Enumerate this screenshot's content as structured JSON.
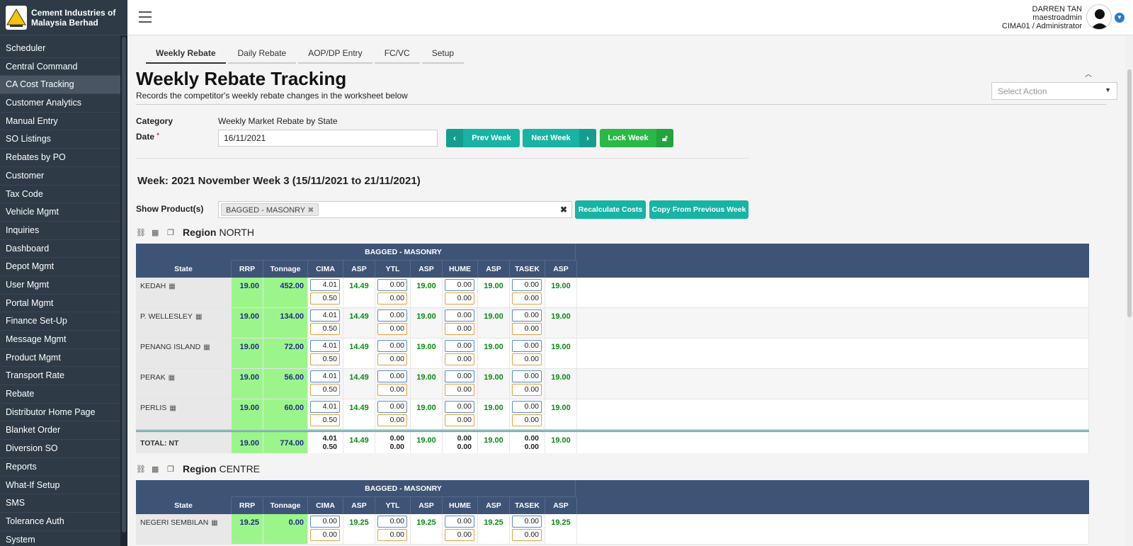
{
  "app": {
    "company_name": "Cement Industries of Malaysia Berhad",
    "user": {
      "name": "DARREN TAN",
      "login": "maestroadmin",
      "role": "CIMA01 / Administrator"
    }
  },
  "sidebar": {
    "items": [
      {
        "label": "Scheduler"
      },
      {
        "label": "Central Command"
      },
      {
        "label": "CA Cost Tracking"
      },
      {
        "label": "Customer Analytics"
      },
      {
        "label": "Manual Entry"
      },
      {
        "label": "SO Listings"
      },
      {
        "label": "Rebates by PO"
      },
      {
        "label": "Customer"
      },
      {
        "label": "Tax Code"
      },
      {
        "label": "Vehicle Mgmt"
      },
      {
        "label": "Inquiries"
      },
      {
        "label": "Dashboard"
      },
      {
        "label": "Depot Mgmt"
      },
      {
        "label": "User Mgmt"
      },
      {
        "label": "Portal Mgmt"
      },
      {
        "label": "Finance Set-Up"
      },
      {
        "label": "Message Mgmt"
      },
      {
        "label": "Product Mgmt"
      },
      {
        "label": "Transport Rate"
      },
      {
        "label": "Rebate"
      },
      {
        "label": "Distributor Home Page"
      },
      {
        "label": "Blanket Order"
      },
      {
        "label": "Diversion SO"
      },
      {
        "label": "Reports"
      },
      {
        "label": "What-If Setup"
      },
      {
        "label": "SMS"
      },
      {
        "label": "Tolerance Auth"
      },
      {
        "label": "System"
      }
    ],
    "active_index": 2
  },
  "tabs": [
    {
      "label": "Weekly Rebate",
      "active": true
    },
    {
      "label": "Daily Rebate"
    },
    {
      "label": "AOP/DP Entry"
    },
    {
      "label": "FC/VC"
    },
    {
      "label": "Setup"
    }
  ],
  "page": {
    "title": "Weekly Rebate Tracking",
    "subtitle": "Records the competitor's weekly rebate changes in the worksheet below",
    "action_placeholder": "Select Action"
  },
  "form": {
    "category_label": "Category",
    "category_value": "Weekly Market Rebate by State",
    "date_label": "Date",
    "date_value": "16/11/2021",
    "prev_week": "Prev Week",
    "next_week": "Next Week",
    "lock_week": "Lock Week"
  },
  "week_title": "Week: 2021 November Week 3 (15/11/2021 to 21/11/2021)",
  "products": {
    "label": "Show Product(s)",
    "selected": "BAGGED - MASONRY",
    "recalc": "Recalculate Costs",
    "copy_prev": "Copy From Previous Week"
  },
  "table_headers": {
    "group": "BAGGED - MASONRY",
    "columns": [
      "State",
      "RRP",
      "Tonnage",
      "CIMA",
      "ASP",
      "YTL",
      "ASP",
      "HUME",
      "ASP",
      "TASEK",
      "ASP"
    ]
  },
  "regions": [
    {
      "label": "Region",
      "name": "NORTH",
      "rows": [
        {
          "state": "KEDAH",
          "rrp": "19.00",
          "tonnage": "452.00",
          "cima": [
            "4.01",
            "0.50"
          ],
          "cima_asp": "14.49",
          "ytl": [
            "0.00",
            "0.00"
          ],
          "ytl_asp": "19.00",
          "hume": [
            "0.00",
            "0.00"
          ],
          "hume_asp": "19.00",
          "tasek": [
            "0.00",
            "0.00"
          ],
          "tasek_asp": "19.00"
        },
        {
          "state": "P. WELLESLEY",
          "rrp": "19.00",
          "tonnage": "134.00",
          "cima": [
            "4.01",
            "0.50"
          ],
          "cima_asp": "14.49",
          "ytl": [
            "0.00",
            "0.00"
          ],
          "ytl_asp": "19.00",
          "hume": [
            "0.00",
            "0.00"
          ],
          "hume_asp": "19.00",
          "tasek": [
            "0.00",
            "0.00"
          ],
          "tasek_asp": "19.00"
        },
        {
          "state": "PENANG ISLAND",
          "rrp": "19.00",
          "tonnage": "72.00",
          "cima": [
            "4.01",
            "0.50"
          ],
          "cima_asp": "14.49",
          "ytl": [
            "0.00",
            "0.00"
          ],
          "ytl_asp": "19.00",
          "hume": [
            "0.00",
            "0.00"
          ],
          "hume_asp": "19.00",
          "tasek": [
            "0.00",
            "0.00"
          ],
          "tasek_asp": "19.00"
        },
        {
          "state": "PERAK",
          "rrp": "19.00",
          "tonnage": "56.00",
          "cima": [
            "4.01",
            "0.50"
          ],
          "cima_asp": "14.49",
          "ytl": [
            "0.00",
            "0.00"
          ],
          "ytl_asp": "19.00",
          "hume": [
            "0.00",
            "0.00"
          ],
          "hume_asp": "19.00",
          "tasek": [
            "0.00",
            "0.00"
          ],
          "tasek_asp": "19.00"
        },
        {
          "state": "PERLIS",
          "rrp": "19.00",
          "tonnage": "60.00",
          "cima": [
            "4.01",
            "0.50"
          ],
          "cima_asp": "14.49",
          "ytl": [
            "0.00",
            "0.00"
          ],
          "ytl_asp": "19.00",
          "hume": [
            "0.00",
            "0.00"
          ],
          "hume_asp": "19.00",
          "tasek": [
            "0.00",
            "0.00"
          ],
          "tasek_asp": "19.00"
        }
      ],
      "total": {
        "label": "TOTAL: NT",
        "rrp": "19.00",
        "tonnage": "774.00",
        "cima": [
          "4.01",
          "0.50"
        ],
        "cima_asp": "14.49",
        "ytl": [
          "0.00",
          "0.00"
        ],
        "ytl_asp": "19.00",
        "hume": [
          "0.00",
          "0.00"
        ],
        "hume_asp": "19.00",
        "tasek": [
          "0.00",
          "0.00"
        ],
        "tasek_asp": "19.00"
      }
    },
    {
      "label": "Region",
      "name": "CENTRE",
      "rows": [
        {
          "state": "NEGERI SEMBILAN",
          "rrp": "19.25",
          "tonnage": "0.00",
          "cima": [
            "0.00",
            "0.00"
          ],
          "cima_asp": "19.25",
          "ytl": [
            "0.00",
            "0.00"
          ],
          "ytl_asp": "19.25",
          "hume": [
            "0.00",
            "0.00"
          ],
          "hume_asp": "19.25",
          "tasek": [
            "0.00",
            "0.00"
          ],
          "tasek_asp": "19.25"
        }
      ]
    }
  ],
  "colors": {
    "sidebar_bg": "#2f3a47",
    "table_header": "#3e5476",
    "teal": "#17b3a3",
    "green": "#28b946",
    "rrp_bg": "#9cf58b",
    "asp_text": "#0a8a11"
  }
}
